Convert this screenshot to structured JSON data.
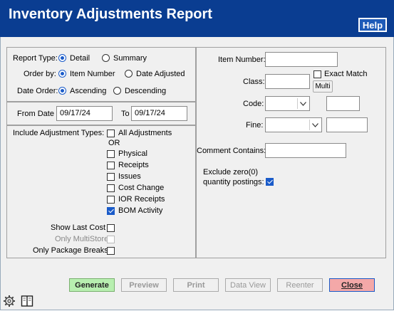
{
  "window": {
    "title": "Inventory Adjustments Report",
    "help_label": "Help"
  },
  "report_type": {
    "label": "Report Type:",
    "options": [
      "Detail",
      "Summary"
    ],
    "selected": "Detail"
  },
  "order_by": {
    "label": "Order by:",
    "options": [
      "Item Number",
      "Date Adjusted"
    ],
    "selected": "Item Number"
  },
  "date_order": {
    "label": "Date Order:",
    "options": [
      "Ascending",
      "Descending"
    ],
    "selected": "Ascending"
  },
  "dates": {
    "from_label": "From Date",
    "from_value": "09/17/24",
    "to_label": "To",
    "to_value": "09/17/24"
  },
  "adjustment_types": {
    "label": "Include Adjustment Types:",
    "all_label": "All Adjustments",
    "or_label": "OR",
    "items": [
      {
        "label": "Physical",
        "checked": false
      },
      {
        "label": "Receipts",
        "checked": false
      },
      {
        "label": "Issues",
        "checked": false
      },
      {
        "label": "Cost Change",
        "checked": false
      },
      {
        "label": "IOR Receipts",
        "checked": false
      },
      {
        "label": "BOM Activity",
        "checked": true
      }
    ]
  },
  "options": {
    "show_last_cost": "Show Last Cost",
    "only_multistore": "Only MultiStore",
    "only_package_breaks": "Only Package Breaks"
  },
  "filters": {
    "item_number_label": "Item Number:",
    "class_label": "Class:",
    "exact_match_label": "Exact Match",
    "multi_label": "Multi",
    "code_label": "Code:",
    "fine_label": "Fine:",
    "comment_label": "Comment Contains:",
    "exclude_zero_line1": "Exclude zero(0)",
    "exclude_zero_line2": "quantity postings:",
    "exclude_zero_checked": true
  },
  "buttons": {
    "generate": "Generate",
    "preview": "Preview",
    "print": "Print",
    "data_view": "Data View",
    "reenter": "Reenter",
    "close": "Close"
  },
  "footer_icons": [
    "gear-icon",
    "book-icon"
  ]
}
